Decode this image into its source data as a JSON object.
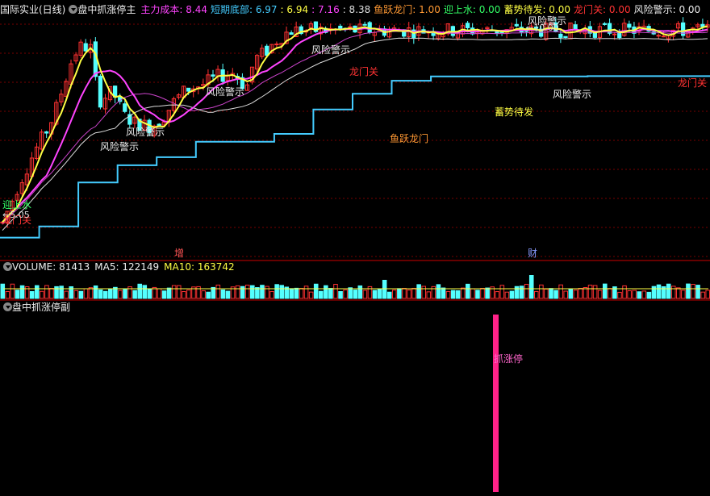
{
  "main_header": {
    "stock": "国际实业(日线)",
    "indicator": "盘中抓涨停主",
    "items": [
      {
        "label": "主力成本:",
        "value": "8.44",
        "color": "#ff44ff"
      },
      {
        "label": "短期底部:",
        "value": "6.97",
        "color": "#44ccff"
      },
      {
        "label": ":",
        "value": "6.94",
        "color": "#ffff44"
      },
      {
        "label": ":",
        "value": "7.16",
        "color": "#ff44ff"
      },
      {
        "label": ":",
        "value": "8.38",
        "color": "#dddddd"
      },
      {
        "label": "鱼跃龙门:",
        "value": "1.00",
        "color": "#ff9933"
      },
      {
        "label": "迎上水:",
        "value": "0.00",
        "color": "#33ff66"
      },
      {
        "label": "蓄势待发:",
        "value": "0.00",
        "color": "#ffff44"
      },
      {
        "label": "龙门关:",
        "value": "0.00",
        "color": "#ff3333"
      },
      {
        "label": "风险警示:",
        "value": "0.00",
        "color": "#eeeeee"
      }
    ]
  },
  "vol_header": {
    "volume": "VOLUME: 81413",
    "ma5": "MA5: 122149",
    "ma10": "MA10: 163742"
  },
  "sub_header": {
    "indicator": "盘中抓涨停副"
  },
  "markers": {
    "low_label": "←5.05",
    "high_label": "←10.00",
    "zeng": "增",
    "cai": "财",
    "zhuazhangting": "抓涨停"
  },
  "chart_data": [
    {
      "type": "candlestick",
      "title": "国际实业(日线)",
      "ylim": [
        4.6,
        10.3
      ],
      "price_range_shown": {
        "low": 5.05,
        "high": 10.0
      },
      "bars": 145,
      "close_trend": [
        [
          0,
          5.4
        ],
        [
          20,
          6.3
        ],
        [
          40,
          7.1
        ],
        [
          55,
          7.6
        ],
        [
          65,
          8.0
        ],
        [
          75,
          8.6
        ],
        [
          85,
          9.2
        ],
        [
          95,
          9.6
        ],
        [
          110,
          9.6
        ],
        [
          120,
          8.3
        ],
        [
          135,
          8.5
        ],
        [
          143,
          8.4
        ],
        [
          150,
          8.0
        ],
        [
          165,
          7.8
        ],
        [
          185,
          7.7
        ],
        [
          200,
          7.9
        ],
        [
          215,
          8.3
        ],
        [
          230,
          8.6
        ],
        [
          250,
          8.7
        ],
        [
          270,
          8.9
        ],
        [
          290,
          9.0
        ],
        [
          305,
          8.6
        ],
        [
          315,
          9.3
        ],
        [
          330,
          9.5
        ],
        [
          345,
          9.8
        ],
        [
          360,
          10.0
        ]
      ],
      "series": [
        {
          "name": "主力成本",
          "color": "#ff44ff"
        },
        {
          "name": "短期底部",
          "color": "#44ccff"
        }
      ],
      "annotations": [
        {
          "text": "迎上水",
          "color": "#33ff66"
        },
        {
          "text": "龙门关",
          "color": "#ff3333"
        },
        {
          "text": "风险警示",
          "color": "#eeeeee"
        },
        {
          "text": "风险警示",
          "color": "#eeeeee"
        },
        {
          "text": "风险警示",
          "color": "#eeeeee"
        },
        {
          "text": "风险警示",
          "color": "#eeeeee"
        },
        {
          "text": "龙门关",
          "color": "#ff3333"
        },
        {
          "text": "鱼跃龙门",
          "color": "#ff9933"
        },
        {
          "text": "风险警示",
          "color": "#eeeeee"
        },
        {
          "text": "蓄势待发",
          "color": "#ffff44"
        },
        {
          "text": "风险警示",
          "color": "#eeeeee"
        },
        {
          "text": "龙门关",
          "color": "#ff3333"
        }
      ]
    },
    {
      "type": "bar",
      "title": "VOLUME",
      "values": {
        "VOLUME": 81413,
        "MA5": 122149,
        "MA10": 163742
      }
    },
    {
      "type": "bar",
      "title": "盘中抓涨停副",
      "signal": {
        "label": "抓涨停",
        "color": "#ff2288"
      }
    }
  ]
}
